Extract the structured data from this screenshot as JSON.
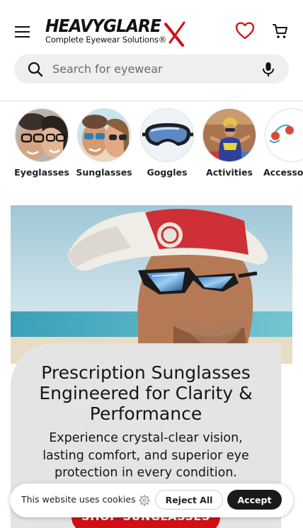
{
  "header": {
    "menu_icon": "hamburger-menu-icon",
    "logo": {
      "main": "HEAVYGLARE",
      "tagline": "Complete Eyewear Solutions®",
      "mark": "X"
    },
    "wishlist_icon": "heart-icon",
    "cart_icon": "cart-icon"
  },
  "search": {
    "placeholder": "Search for eyewear",
    "value": "",
    "icon": "search-icon",
    "voice_icon": "microphone-icon"
  },
  "categories": [
    {
      "label": "Eyeglasses"
    },
    {
      "label": "Sunglasses"
    },
    {
      "label": "Goggles"
    },
    {
      "label": "Activities"
    },
    {
      "label": "Accessories"
    }
  ],
  "hero": {
    "title": "Prescription Sunglasses Engineered for Clarity & Performance",
    "subtitle": "Experience crystal-clear vision, lasting comfort, and superior eye protection in every condition.",
    "cta": "SHOP SUNGLASSES"
  },
  "cookie_bar": {
    "text": "This website uses cookies",
    "settings_icon": "gear-icon",
    "reject_label": "Reject All",
    "accept_label": "Accept"
  },
  "colors": {
    "brand_red": "#d10f16",
    "heart_red": "#d10f16",
    "search_bg": "#efefef",
    "card_bg": "#e4e4e4",
    "accept_bg": "#1a1a1a"
  }
}
